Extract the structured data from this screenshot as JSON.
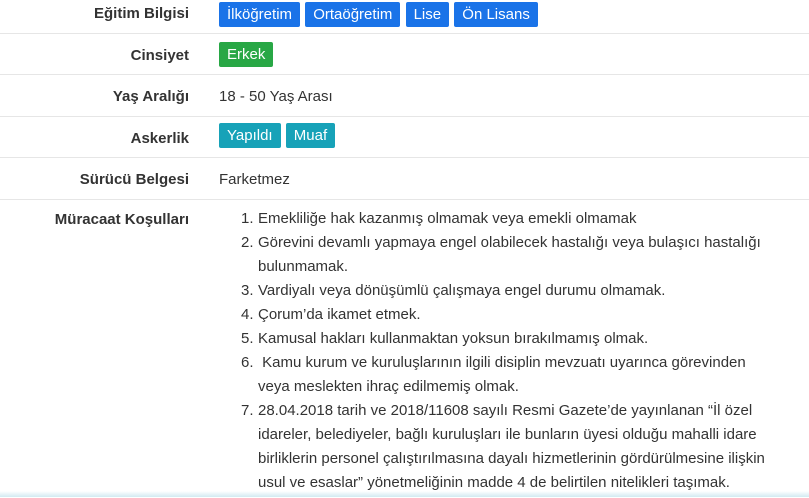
{
  "colors": {
    "primary": "#1a73e8",
    "success": "#28a745",
    "info": "#17a2b8"
  },
  "rows": {
    "education": {
      "label": "Eğitim Bilgisi",
      "badges": [
        "İlköğretim",
        "Ortaöğretim",
        "Lise",
        "Ön Lisans"
      ]
    },
    "gender": {
      "label": "Cinsiyet",
      "badges": [
        "Erkek"
      ]
    },
    "age": {
      "label": "Yaş Aralığı",
      "value": "18 - 50 Yaş Arası"
    },
    "military": {
      "label": "Askerlik",
      "badges": [
        "Yapıldı",
        "Muaf"
      ]
    },
    "license": {
      "label": "Sürücü Belgesi",
      "value": "Farketmez"
    },
    "conditions": {
      "label": "Müracaat Koşulları",
      "items": [
        {
          "num": "1.",
          "lines": [
            "Emekliliğe hak kazanmış olmamak veya emekli olmamak"
          ]
        },
        {
          "num": "2.",
          "lines": [
            "Görevini devamlı yapmaya engel olabilecek hastalığı veya bulaşıcı hastalığı",
            "bulunmamak."
          ]
        },
        {
          "num": "3.",
          "lines": [
            "Vardiyalı veya dönüşümlü çalışmaya engel durumu olmamak."
          ]
        },
        {
          "num": "4.",
          "lines": [
            "Çorum’da ikamet etmek."
          ]
        },
        {
          "num": "5.",
          "lines": [
            "Kamusal hakları kullanmaktan yoksun bırakılmamış olmak."
          ]
        },
        {
          "num": "6.",
          "lines": [
            " Kamu kurum ve kuruluşlarının ilgili disiplin mevzuatı uyarınca görevinden",
            "veya meslekten ihraç edilmemiş olmak."
          ]
        },
        {
          "num": "7.",
          "lines": [
            "28.04.2018 tarih ve 2018/11608 sayılı Resmi Gazete’de yayınlanan “İl özel",
            "idareler, belediyeler, bağlı kuruluşları ile bunların üyesi olduğu mahalli idare",
            "birliklerin personel çalıştırılmasına dayalı hizmetlerinin gördürülmesine ilişkin",
            "usul ve esaslar” yönetmeliğinin madde 4 de belirtilen nitelikleri taşımak."
          ]
        }
      ]
    }
  }
}
